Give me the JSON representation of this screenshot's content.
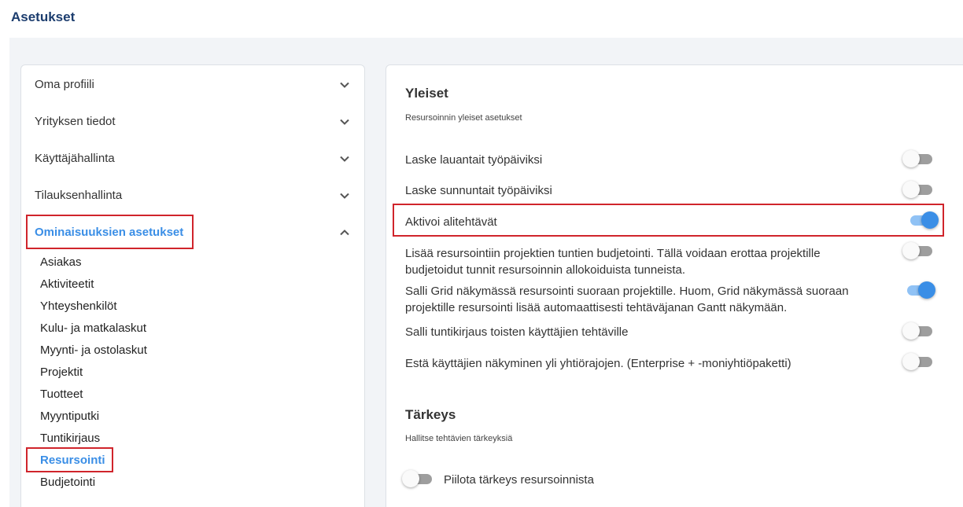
{
  "page": {
    "title": "Asetukset"
  },
  "left_menu": {
    "items": [
      {
        "label": "Oma profiili"
      },
      {
        "label": "Yrityksen tiedot"
      },
      {
        "label": "Käyttäjähallinta"
      },
      {
        "label": "Tilauksenhallinta"
      },
      {
        "label": "Ominaisuuksien asetukset"
      }
    ],
    "sub_items": [
      {
        "label": "Asiakas"
      },
      {
        "label": "Aktiviteetit"
      },
      {
        "label": "Yhteyshenkilöt"
      },
      {
        "label": "Kulu- ja matkalaskut"
      },
      {
        "label": "Myynti- ja ostolaskut"
      },
      {
        "label": "Projektit"
      },
      {
        "label": "Tuotteet"
      },
      {
        "label": "Myyntiputki"
      },
      {
        "label": "Tuntikirjaus"
      },
      {
        "label": "Resursointi"
      },
      {
        "label": "Budjetointi"
      }
    ]
  },
  "general": {
    "title": "Yleiset",
    "subtitle": "Resursoinnin yleiset asetukset",
    "settings": [
      {
        "label": "Laske lauantait työpäiviksi",
        "enabled": false
      },
      {
        "label": "Laske sunnuntait työpäiviksi",
        "enabled": false
      },
      {
        "label": "Aktivoi alitehtävät",
        "enabled": true
      },
      {
        "label": "Lisää resursointiin projektien tuntien budjetointi. Tällä voidaan erottaa projektille budjetoidut tunnit resursoinnin allokoiduista tunneista.",
        "enabled": false
      },
      {
        "label": "Salli Grid näkymässä resursointi suoraan projektille. Huom, Grid näkymässä suoraan projektille resursointi lisää automaattisesti tehtäväjanan Gantt näkymään.",
        "enabled": true
      },
      {
        "label": "Salli tuntikirjaus toisten käyttäjien tehtäville",
        "enabled": false
      },
      {
        "label": "Estä käyttäjien näkyminen yli yhtiörajojen. (Enterprise + -moniyhtiöpaketti)",
        "enabled": false
      }
    ]
  },
  "priority": {
    "title": "Tärkeys",
    "subtitle": "Hallitse tehtävien tärkeyksiä",
    "settings": [
      {
        "label": "Piilota tärkeys resursoinnista",
        "enabled": false
      }
    ]
  },
  "colors": {
    "accent": "#3a8ee6",
    "highlight": "#d0242b",
    "title": "#1c3d6e"
  }
}
